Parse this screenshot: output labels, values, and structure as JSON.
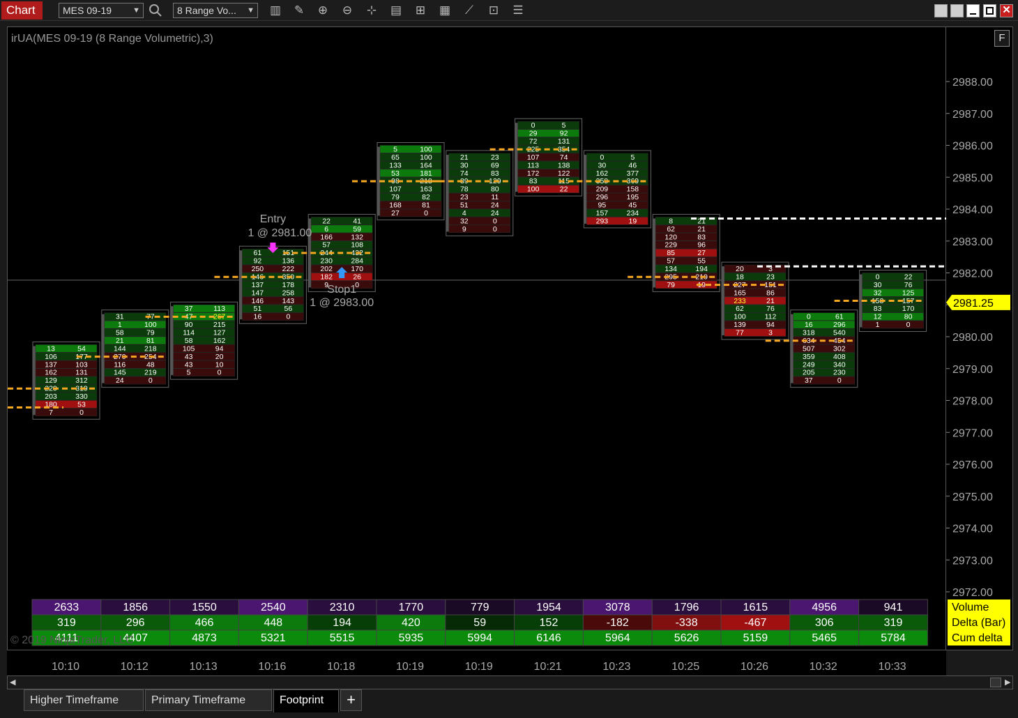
{
  "toolbar": {
    "title": "Chart",
    "instrument": "MES 09-19",
    "bar_type": "8 Range Vo...",
    "icons": [
      "search-icon",
      "bar-type-icon",
      "drawing-tool-icon",
      "zoom-in-icon",
      "zoom-out-icon",
      "crosshair-icon",
      "data-box-icon",
      "properties-icon",
      "indicators-icon",
      "strategies-icon",
      "templates-icon",
      "menu-list-icon"
    ]
  },
  "window_buttons": [
    "pin-icon",
    "link-icon",
    "minimize-icon",
    "maximize-icon",
    "close-icon"
  ],
  "chart": {
    "label": "irUA(MES 09-19 (8 Range Volumetric),3)",
    "copyright": "© 2019 NinjaTrader, LLC",
    "f_button": "F",
    "current_price": "2981.25",
    "entry": {
      "title": "Entry",
      "detail": "1 @ 2981.00"
    },
    "stop": {
      "title": "Stop1",
      "detail": "1 @ 2983.00"
    }
  },
  "colors": {
    "ask_bg": "#0b3a0b",
    "bid_bg": "#3a0b0b",
    "strong_ask": "#0c7a0c",
    "strong_bid": "#a01010",
    "poc": "#f7a722",
    "current_price_bg": "#ffff00",
    "purple": "#4a1670"
  },
  "chart_data": {
    "type": "table",
    "price_axis": {
      "min": 2972.0,
      "max": 2988.0,
      "step": 1.0
    },
    "price_labels": [
      "2988.00",
      "2987.00",
      "2986.00",
      "2985.00",
      "2984.00",
      "2983.00",
      "2982.00",
      "2981.00",
      "2980.00",
      "2979.00",
      "2978.00",
      "2977.00",
      "2976.00",
      "2975.00",
      "2974.00",
      "2973.00",
      "2972.00"
    ],
    "time_labels": [
      "10:10",
      "10:12",
      "10:13",
      "10:16",
      "10:18",
      "10:19",
      "10:19",
      "10:21",
      "10:23",
      "10:25",
      "10:26",
      "10:32",
      "10:33"
    ],
    "summary": {
      "labels": [
        "Volume",
        "Delta (Bar)",
        "Cum delta"
      ],
      "volume": [
        2633,
        1856,
        1550,
        2540,
        2310,
        1770,
        779,
        1954,
        3078,
        1796,
        1615,
        4956,
        941
      ],
      "delta": [
        319,
        296,
        466,
        448,
        194,
        420,
        59,
        152,
        -182,
        -338,
        -467,
        306,
        319
      ],
      "cum_delta": [
        4111,
        4407,
        4873,
        5321,
        5515,
        5935,
        5994,
        6146,
        5964,
        5626,
        5159,
        5465,
        5784
      ]
    },
    "bars": [
      {
        "top_price": 2979.75,
        "rows": [
          [
            13,
            54
          ],
          [
            106,
            177
          ],
          [
            137,
            103
          ],
          [
            162,
            131
          ],
          [
            129,
            312
          ],
          [
            220,
            319
          ],
          [
            203,
            330
          ],
          [
            180,
            53
          ],
          [
            7,
            0
          ]
        ]
      },
      {
        "top_price": 2980.75,
        "rows": [
          [
            31,
            77
          ],
          [
            1,
            100
          ],
          [
            58,
            79
          ],
          [
            21,
            81
          ],
          [
            144,
            218
          ],
          [
            270,
            254
          ],
          [
            116,
            48
          ],
          [
            145,
            219
          ],
          [
            24,
            0
          ]
        ]
      },
      {
        "top_price": 2981.0,
        "rows": [
          [
            37,
            113
          ],
          [
            47,
            267
          ],
          [
            90,
            215
          ],
          [
            114,
            127
          ],
          [
            58,
            162
          ],
          [
            105,
            94
          ],
          [
            43,
            20
          ],
          [
            43,
            10
          ],
          [
            5,
            0
          ]
        ]
      },
      {
        "top_price": 2982.75,
        "rows": [
          [
            61,
            151
          ],
          [
            92,
            136
          ],
          [
            250,
            222
          ],
          [
            146,
            350
          ],
          [
            137,
            178
          ],
          [
            147,
            258
          ],
          [
            146,
            143
          ],
          [
            51,
            56
          ],
          [
            16,
            0
          ]
        ]
      },
      {
        "top_price": 2983.75,
        "rows": [
          [
            22,
            41
          ],
          [
            6,
            59
          ],
          [
            166,
            132
          ],
          [
            57,
            108
          ],
          [
            244,
            432
          ],
          [
            230,
            284
          ],
          [
            202,
            170
          ],
          [
            182,
            26
          ],
          [
            9,
            0
          ]
        ]
      },
      {
        "top_price": 2986.0,
        "rows": [
          [
            5,
            100
          ],
          [
            65,
            100
          ],
          [
            133,
            164
          ],
          [
            53,
            181
          ],
          [
            98,
            218
          ],
          [
            107,
            163
          ],
          [
            79,
            82
          ],
          [
            168,
            81
          ],
          [
            27,
            0
          ]
        ]
      },
      {
        "top_price": 2985.75,
        "rows": [
          [
            21,
            23
          ],
          [
            30,
            69
          ],
          [
            74,
            83
          ],
          [
            89,
            129
          ],
          [
            78,
            80
          ],
          [
            23,
            11
          ],
          [
            51,
            24
          ],
          [
            4,
            24
          ],
          [
            32,
            0
          ],
          [
            9,
            0
          ]
        ]
      },
      {
        "top_price": 2986.75,
        "rows": [
          [
            0,
            5
          ],
          [
            29,
            92
          ],
          [
            72,
            131
          ],
          [
            225,
            354
          ],
          [
            107,
            74
          ],
          [
            113,
            138
          ],
          [
            172,
            122
          ],
          [
            83,
            115
          ],
          [
            100,
            22
          ]
        ]
      },
      {
        "top_price": 2985.75,
        "rows": [
          [
            0,
            5
          ],
          [
            30,
            46
          ],
          [
            162,
            377
          ],
          [
            358,
            369
          ],
          [
            209,
            158
          ],
          [
            296,
            195
          ],
          [
            95,
            45
          ],
          [
            157,
            234
          ],
          [
            293,
            19
          ]
        ]
      },
      {
        "top_price": 2983.75,
        "rows": [
          [
            8,
            21
          ],
          [
            62,
            21
          ],
          [
            120,
            83
          ],
          [
            229,
            96
          ],
          [
            85,
            27
          ],
          [
            57,
            55
          ],
          [
            134,
            194
          ],
          [
            295,
            219
          ],
          [
            79,
            19
          ]
        ]
      },
      {
        "top_price": 2982.25,
        "rows": [
          [
            20,
            3
          ],
          [
            18,
            23
          ],
          [
            227,
            151
          ],
          [
            165,
            86
          ],
          [
            233,
            21
          ],
          [
            62,
            76
          ],
          [
            100,
            112
          ],
          [
            139,
            94
          ],
          [
            77,
            3
          ]
        ]
      },
      {
        "top_price": 2980.75,
        "rows": [
          [
            0,
            61
          ],
          [
            16,
            296
          ],
          [
            318,
            540
          ],
          [
            634,
            454
          ],
          [
            507,
            302
          ],
          [
            359,
            408
          ],
          [
            249,
            340
          ],
          [
            205,
            230
          ],
          [
            37,
            0
          ]
        ]
      },
      {
        "top_price": 2982.0,
        "rows": [
          [
            0,
            22
          ],
          [
            30,
            76
          ],
          [
            32,
            125
          ],
          [
            153,
            157
          ],
          [
            83,
            170
          ],
          [
            12,
            80
          ],
          [
            1,
            0
          ]
        ]
      }
    ]
  },
  "tabs": [
    {
      "label": "Higher Timeframe"
    },
    {
      "label": "Primary Timeframe"
    },
    {
      "label": "Footprint"
    }
  ],
  "tab_add": "+"
}
